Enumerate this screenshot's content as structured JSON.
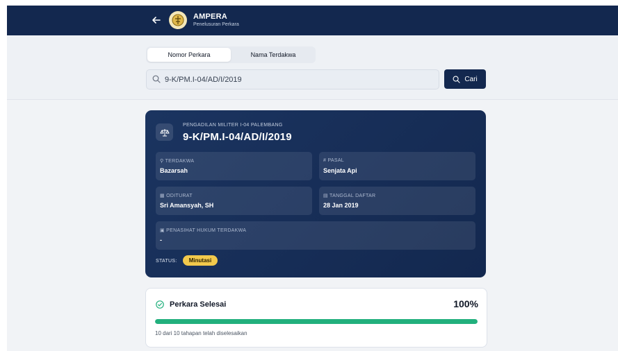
{
  "header": {
    "app_name": "AMPERA",
    "subtitle": "Penelusuran Perkara",
    "back_icon": "arrow-left-icon",
    "logo_icon": "emblem-logo"
  },
  "search": {
    "tabs": [
      {
        "label": "Nomor Perkara",
        "active": true
      },
      {
        "label": "Nama Terdakwa",
        "active": false
      }
    ],
    "query": "9-K/PM.I-04/AD/I/2019",
    "button_label": "Cari"
  },
  "case": {
    "court": "PENGADILAN MILITER I-04 PALEMBANG",
    "number": "9-K/PM.I-04/AD/I/2019",
    "fields": {
      "terdakwa": {
        "label": "TERDAKWA",
        "value": "Bazarsah",
        "icon": "person-icon"
      },
      "pasal": {
        "label": "PASAL",
        "value": "Senjata Api",
        "icon": "hash-icon"
      },
      "oditurat": {
        "label": "ODITURAT",
        "value": "Sri Amansyah, SH",
        "icon": "building-icon"
      },
      "tanggal": {
        "label": "TANGGAL DAFTAR",
        "value": "28 Jan 2019",
        "icon": "calendar-icon"
      },
      "penasihat": {
        "label": "PENASIHAT HUKUM TERDAKWA",
        "value": "-",
        "icon": "briefcase-icon"
      }
    },
    "status_label": "STATUS:",
    "status_value": "Minutasi"
  },
  "progress": {
    "title": "Perkara Selesai",
    "percent_label": "100%",
    "percent": 100,
    "note": "10 dari 10 tahapan telah diselesaikan"
  },
  "colors": {
    "navy": "#13284f",
    "accent_gold": "#f2c94c",
    "success": "#22b07d"
  }
}
